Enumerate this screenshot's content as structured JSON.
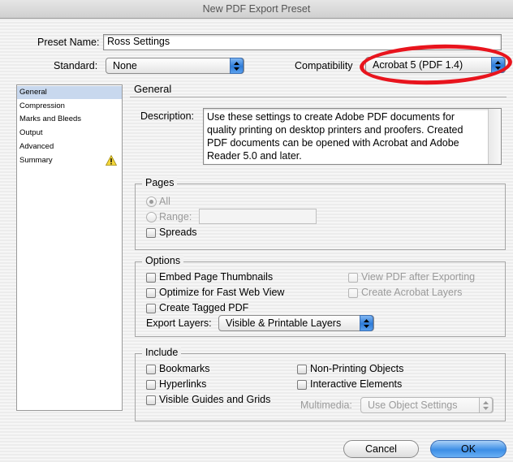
{
  "window": {
    "title": "New PDF Export Preset"
  },
  "preset": {
    "label": "Preset Name:",
    "value": "Ross Settings"
  },
  "standard": {
    "label": "Standard:",
    "value": "None"
  },
  "compatibility": {
    "label": "Compatibility",
    "value": "Acrobat 5 (PDF 1.4)",
    "highlight_color": "#e8141d"
  },
  "sidebar": {
    "items": [
      {
        "label": "General",
        "selected": true
      },
      {
        "label": "Compression"
      },
      {
        "label": "Marks and Bleeds"
      },
      {
        "label": "Output"
      },
      {
        "label": "Advanced"
      },
      {
        "label": "Summary",
        "icon": "warning-icon"
      }
    ]
  },
  "general": {
    "title": "General",
    "description_label": "Description:",
    "description_lines": [
      "Use these settings to create Adobe PDF documents for",
      "quality printing on desktop printers and proofers.  Created",
      "PDF documents can be opened with Acrobat and Adobe",
      "Reader 5.0 and later."
    ]
  },
  "pages": {
    "title": "Pages",
    "all_label": "All",
    "range_label": "Range:",
    "range_value": "",
    "spreads_label": "Spreads"
  },
  "options": {
    "title": "Options",
    "embed_thumbnails": "Embed Page Thumbnails",
    "optimize_web": "Optimize for Fast Web View",
    "tagged_pdf": "Create Tagged PDF",
    "view_after": "View PDF after Exporting",
    "acrobat_layers": "Create Acrobat Layers",
    "export_layers_label": "Export Layers:",
    "export_layers_value": "Visible & Printable Layers"
  },
  "include": {
    "title": "Include",
    "bookmarks": "Bookmarks",
    "hyperlinks": "Hyperlinks",
    "guides_grids": "Visible Guides and Grids",
    "non_printing": "Non-Printing Objects",
    "interactive": "Interactive Elements",
    "multimedia_label": "Multimedia:",
    "multimedia_value": "Use Object Settings"
  },
  "buttons": {
    "cancel": "Cancel",
    "ok": "OK"
  },
  "colors": {
    "accent": "#3c8ee6",
    "selection": "#c8d8ee"
  }
}
